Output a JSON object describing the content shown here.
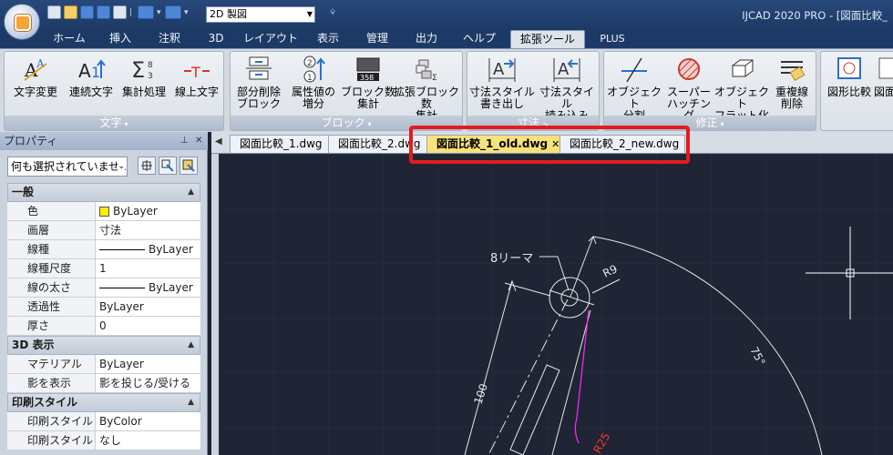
{
  "titlebar": {
    "workspace": "2D 製図",
    "title": "IJCAD 2020 PRO - [図面比較_"
  },
  "ribbon_tabs": [
    "ホーム",
    "挿入",
    "注釈",
    "3D",
    "レイアウト",
    "表示",
    "管理",
    "出力",
    "ヘルプ",
    "拡張ツール",
    "PLUS"
  ],
  "ribbon_active_tab": "拡張ツール",
  "ribbon": {
    "groups": {
      "moji": {
        "label": "文字",
        "buttons": [
          "文字変更",
          "連続文字",
          "集計処理",
          "線上文字"
        ]
      },
      "block": {
        "label": "ブロック",
        "buttons": [
          "部分削除\nブロック",
          "属性値の\n増分",
          "ブロック数\n集計",
          "拡張ブロック数\n集計"
        ]
      },
      "sunpo": {
        "label": "寸法",
        "buttons": [
          "寸法スタイル\n書き出し",
          "寸法スタイル\n読み込み"
        ]
      },
      "shusei": {
        "label": "修正",
        "buttons": [
          "オブジェクト\n分割",
          "スーパー\nハッチング",
          "オブジェクト\nフラット化",
          "重複線\n削除"
        ]
      },
      "hikaku": {
        "label": "",
        "buttons": [
          "図形比較",
          "図面"
        ]
      }
    },
    "icon_text": {
      "sigma_digits": "8\n3",
      "block_count": "358"
    }
  },
  "properties": {
    "title": "プロパティ",
    "selection": "何も選択されていませ...",
    "sections": [
      {
        "name": "一般",
        "rows": [
          {
            "key": "色",
            "value": "ByLayer",
            "swatch": "#ffee00"
          },
          {
            "key": "画層",
            "value": "寸法"
          },
          {
            "key": "線種",
            "value": "ByLayer",
            "line": true
          },
          {
            "key": "線種尺度",
            "value": "1"
          },
          {
            "key": "線の太さ",
            "value": "ByLayer",
            "line": true
          },
          {
            "key": "透過性",
            "value": "ByLayer"
          },
          {
            "key": "厚さ",
            "value": "0"
          }
        ]
      },
      {
        "name": "3D 表示",
        "rows": [
          {
            "key": "マテリアル",
            "value": "ByLayer"
          },
          {
            "key": "影を表示",
            "value": "影を投じる/受ける"
          }
        ]
      },
      {
        "name": "印刷スタイル",
        "rows": [
          {
            "key": "印刷スタイル",
            "value": "ByColor"
          },
          {
            "key": "印刷スタイル ...",
            "value": "なし"
          }
        ]
      }
    ]
  },
  "doc_tabs": [
    {
      "label": "図面比較_1.dwg",
      "active": false
    },
    {
      "label": "図面比較_2.dwg",
      "active": false
    },
    {
      "label": "図面比較_1_old.dwg",
      "active": true
    },
    {
      "label": "図面比較_2_new.dwg",
      "active": false
    }
  ],
  "drawing": {
    "labels": {
      "reamer": "8リーマ",
      "radius": "R9",
      "angle": "75°",
      "length": "100",
      "r25": "R25"
    }
  },
  "colors": {
    "accent": "#1d3a66",
    "highlight": "#e21c1c",
    "active_tab": "#f7e27b",
    "canvas": "#1f2534"
  }
}
